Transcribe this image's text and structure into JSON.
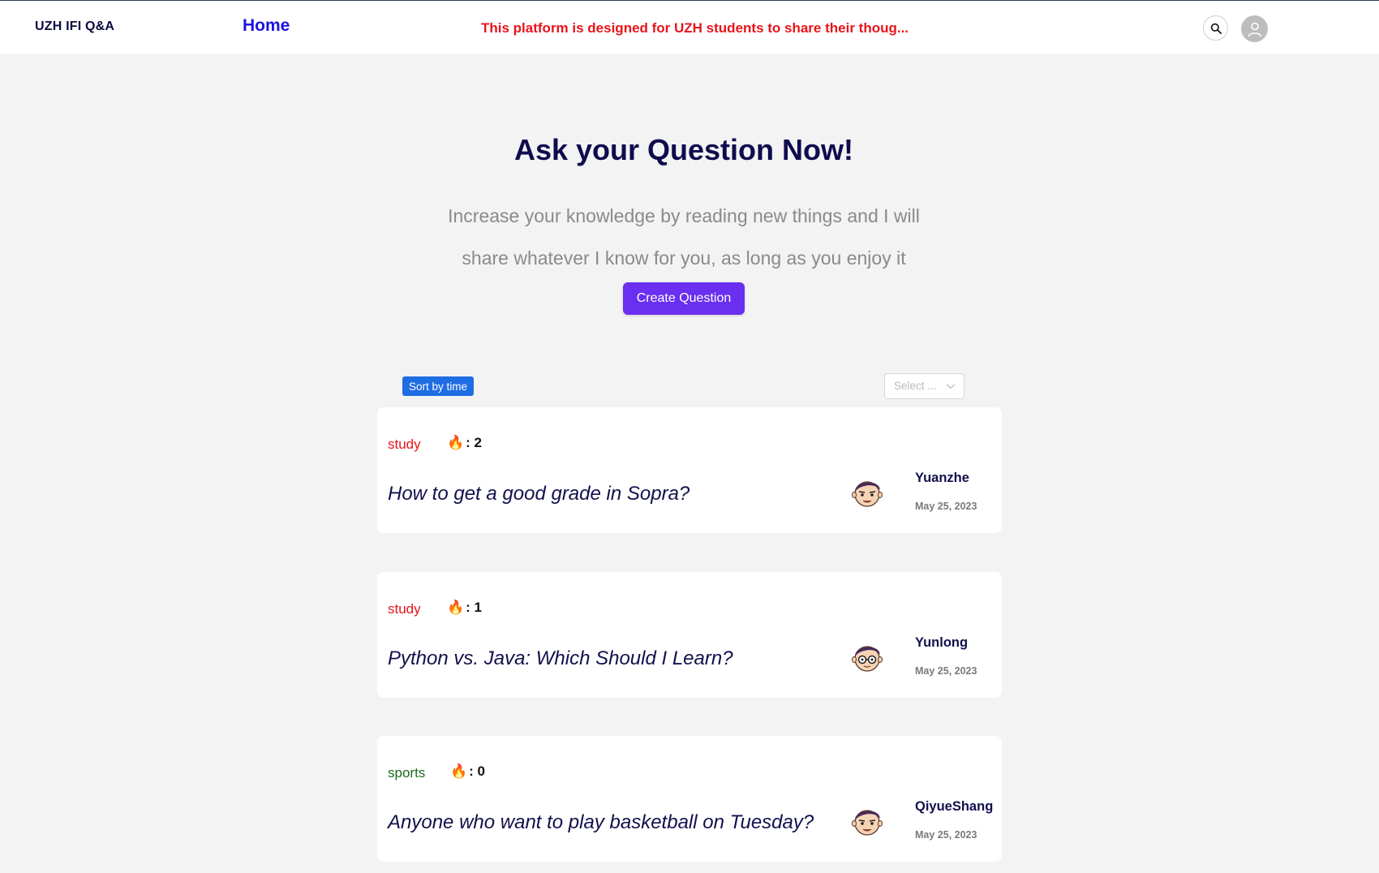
{
  "header": {
    "brand": "UZH IFI Q&A",
    "nav_home": "Home",
    "announcement": "This platform is designed for UZH students to share their thoug..."
  },
  "hero": {
    "title": "Ask your Question Now!",
    "subtitle_line1": "Increase your knowledge by reading new things and I will",
    "subtitle_line2": "share whatever I know for you, as long as you enjoy it",
    "create_button": "Create Question"
  },
  "controls": {
    "sort_button": "Sort by time",
    "select_placeholder": "Select ..."
  },
  "colors": {
    "accent": "#6a2ff0",
    "sort": "#1f6de3",
    "tag_study": "#e8141b",
    "tag_sports": "#1b6b1b",
    "announcement": "#e8141b"
  },
  "questions": [
    {
      "tag": "study",
      "tag_color": "#e8141b",
      "heat": ": 2",
      "title": "How to get a good grade in Sopra?",
      "author": "Yuanzhe",
      "date": "May 25, 2023",
      "avatar": "cartoon-face-icon"
    },
    {
      "tag": "study",
      "tag_color": "#e8141b",
      "heat": ": 1",
      "title": "Python vs. Java: Which Should I Learn?",
      "author": "Yunlong",
      "date": "May 25, 2023",
      "avatar": "cartoon-face-glasses-icon"
    },
    {
      "tag": "sports",
      "tag_color": "#1b6b1b",
      "heat": ": 0",
      "title": "Anyone who want to play basketball on Tuesday?",
      "author": "QiyueShang",
      "date": "May 25, 2023",
      "avatar": "cartoon-face-icon"
    }
  ]
}
